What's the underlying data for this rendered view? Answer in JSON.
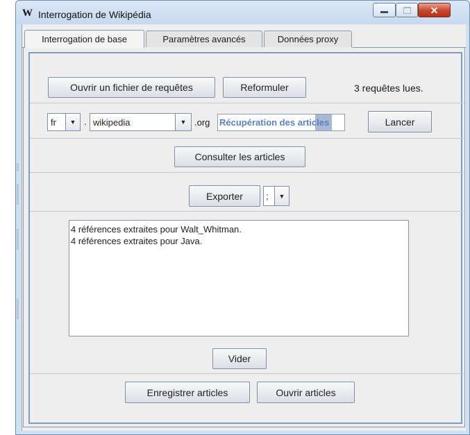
{
  "window": {
    "title": "Interrogation de Wikipédia",
    "logo": "W",
    "controls": [
      "minimize-icon",
      "maximize-icon",
      "close-icon"
    ]
  },
  "tabs": [
    {
      "label": "Interrogation de base",
      "active": true
    },
    {
      "label": "Paramètres avancés",
      "active": false
    },
    {
      "label": "Données proxy",
      "active": false
    }
  ],
  "row1": {
    "open_queries_label": "Ouvrir un fichier de requêtes",
    "reformulate_label": "Reformuler",
    "status": "3 requêtes lues."
  },
  "row2": {
    "lang_value": "fr",
    "dot": ".",
    "site_value": "wikipedia",
    "domain_suffix": ".org",
    "progress_text": "Récupération des articles",
    "launch_label": "Lancer"
  },
  "row3": {
    "consult_label": "Consulter les articles"
  },
  "row4": {
    "export_label": "Exporter",
    "separator_value": ";"
  },
  "log": {
    "lines": [
      "4 références extraites pour Walt_Whitman.",
      "4 références extraites pour Java."
    ]
  },
  "clear_label": "Vider",
  "bottom": {
    "save_label": "Enregistrer articles",
    "open_label": "Ouvrir articles"
  },
  "colors": {
    "accent": "#4f74b8",
    "progress_text": "#5a7fc4",
    "progress_highlight": "#a9b9d4",
    "close_button": "#c8442c"
  }
}
